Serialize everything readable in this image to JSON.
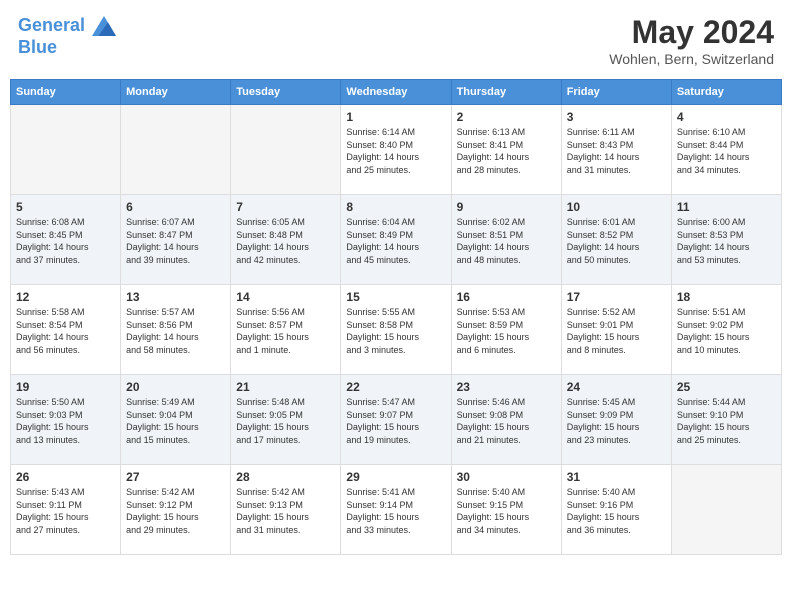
{
  "header": {
    "logo_line1": "General",
    "logo_line2": "Blue",
    "month_year": "May 2024",
    "location": "Wohlen, Bern, Switzerland"
  },
  "weekdays": [
    "Sunday",
    "Monday",
    "Tuesday",
    "Wednesday",
    "Thursday",
    "Friday",
    "Saturday"
  ],
  "weeks": [
    [
      {
        "day": "",
        "info": ""
      },
      {
        "day": "",
        "info": ""
      },
      {
        "day": "",
        "info": ""
      },
      {
        "day": "1",
        "info": "Sunrise: 6:14 AM\nSunset: 8:40 PM\nDaylight: 14 hours\nand 25 minutes."
      },
      {
        "day": "2",
        "info": "Sunrise: 6:13 AM\nSunset: 8:41 PM\nDaylight: 14 hours\nand 28 minutes."
      },
      {
        "day": "3",
        "info": "Sunrise: 6:11 AM\nSunset: 8:43 PM\nDaylight: 14 hours\nand 31 minutes."
      },
      {
        "day": "4",
        "info": "Sunrise: 6:10 AM\nSunset: 8:44 PM\nDaylight: 14 hours\nand 34 minutes."
      }
    ],
    [
      {
        "day": "5",
        "info": "Sunrise: 6:08 AM\nSunset: 8:45 PM\nDaylight: 14 hours\nand 37 minutes."
      },
      {
        "day": "6",
        "info": "Sunrise: 6:07 AM\nSunset: 8:47 PM\nDaylight: 14 hours\nand 39 minutes."
      },
      {
        "day": "7",
        "info": "Sunrise: 6:05 AM\nSunset: 8:48 PM\nDaylight: 14 hours\nand 42 minutes."
      },
      {
        "day": "8",
        "info": "Sunrise: 6:04 AM\nSunset: 8:49 PM\nDaylight: 14 hours\nand 45 minutes."
      },
      {
        "day": "9",
        "info": "Sunrise: 6:02 AM\nSunset: 8:51 PM\nDaylight: 14 hours\nand 48 minutes."
      },
      {
        "day": "10",
        "info": "Sunrise: 6:01 AM\nSunset: 8:52 PM\nDaylight: 14 hours\nand 50 minutes."
      },
      {
        "day": "11",
        "info": "Sunrise: 6:00 AM\nSunset: 8:53 PM\nDaylight: 14 hours\nand 53 minutes."
      }
    ],
    [
      {
        "day": "12",
        "info": "Sunrise: 5:58 AM\nSunset: 8:54 PM\nDaylight: 14 hours\nand 56 minutes."
      },
      {
        "day": "13",
        "info": "Sunrise: 5:57 AM\nSunset: 8:56 PM\nDaylight: 14 hours\nand 58 minutes."
      },
      {
        "day": "14",
        "info": "Sunrise: 5:56 AM\nSunset: 8:57 PM\nDaylight: 15 hours\nand 1 minute."
      },
      {
        "day": "15",
        "info": "Sunrise: 5:55 AM\nSunset: 8:58 PM\nDaylight: 15 hours\nand 3 minutes."
      },
      {
        "day": "16",
        "info": "Sunrise: 5:53 AM\nSunset: 8:59 PM\nDaylight: 15 hours\nand 6 minutes."
      },
      {
        "day": "17",
        "info": "Sunrise: 5:52 AM\nSunset: 9:01 PM\nDaylight: 15 hours\nand 8 minutes."
      },
      {
        "day": "18",
        "info": "Sunrise: 5:51 AM\nSunset: 9:02 PM\nDaylight: 15 hours\nand 10 minutes."
      }
    ],
    [
      {
        "day": "19",
        "info": "Sunrise: 5:50 AM\nSunset: 9:03 PM\nDaylight: 15 hours\nand 13 minutes."
      },
      {
        "day": "20",
        "info": "Sunrise: 5:49 AM\nSunset: 9:04 PM\nDaylight: 15 hours\nand 15 minutes."
      },
      {
        "day": "21",
        "info": "Sunrise: 5:48 AM\nSunset: 9:05 PM\nDaylight: 15 hours\nand 17 minutes."
      },
      {
        "day": "22",
        "info": "Sunrise: 5:47 AM\nSunset: 9:07 PM\nDaylight: 15 hours\nand 19 minutes."
      },
      {
        "day": "23",
        "info": "Sunrise: 5:46 AM\nSunset: 9:08 PM\nDaylight: 15 hours\nand 21 minutes."
      },
      {
        "day": "24",
        "info": "Sunrise: 5:45 AM\nSunset: 9:09 PM\nDaylight: 15 hours\nand 23 minutes."
      },
      {
        "day": "25",
        "info": "Sunrise: 5:44 AM\nSunset: 9:10 PM\nDaylight: 15 hours\nand 25 minutes."
      }
    ],
    [
      {
        "day": "26",
        "info": "Sunrise: 5:43 AM\nSunset: 9:11 PM\nDaylight: 15 hours\nand 27 minutes."
      },
      {
        "day": "27",
        "info": "Sunrise: 5:42 AM\nSunset: 9:12 PM\nDaylight: 15 hours\nand 29 minutes."
      },
      {
        "day": "28",
        "info": "Sunrise: 5:42 AM\nSunset: 9:13 PM\nDaylight: 15 hours\nand 31 minutes."
      },
      {
        "day": "29",
        "info": "Sunrise: 5:41 AM\nSunset: 9:14 PM\nDaylight: 15 hours\nand 33 minutes."
      },
      {
        "day": "30",
        "info": "Sunrise: 5:40 AM\nSunset: 9:15 PM\nDaylight: 15 hours\nand 34 minutes."
      },
      {
        "day": "31",
        "info": "Sunrise: 5:40 AM\nSunset: 9:16 PM\nDaylight: 15 hours\nand 36 minutes."
      },
      {
        "day": "",
        "info": ""
      }
    ]
  ]
}
